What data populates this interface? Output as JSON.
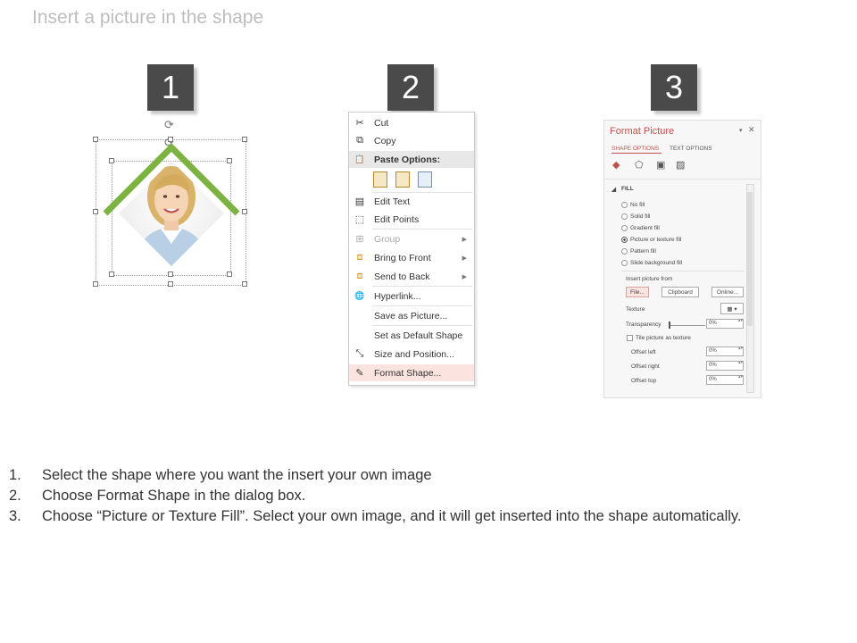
{
  "slide": {
    "title": "Insert a picture in the shape"
  },
  "steps": [
    "1",
    "2",
    "3"
  ],
  "shape": {
    "accent_color": "#7cb342",
    "shape_type": "diamond-with-roof",
    "image": "woman-portrait"
  },
  "context_menu": {
    "items": [
      {
        "icon": "scissors-icon",
        "glyph": "✂",
        "label": "Cut"
      },
      {
        "icon": "copy-icon",
        "glyph": "⧉",
        "label": "Copy"
      },
      {
        "icon": "paste-icon",
        "glyph": "📋",
        "label": "Paste Options:"
      },
      {
        "icon": "edit-text-icon",
        "glyph": "▤",
        "label": "Edit Text"
      },
      {
        "icon": "edit-points-icon",
        "glyph": "⬚",
        "label": "Edit Points"
      },
      {
        "icon": "group-icon",
        "glyph": "⊞",
        "label": "Group"
      },
      {
        "icon": "bring-to-front-icon",
        "glyph": "⧈",
        "label": "Bring to Front"
      },
      {
        "icon": "send-to-back-icon",
        "glyph": "⧈",
        "label": "Send to Back"
      },
      {
        "icon": "hyperlink-icon",
        "glyph": "🌐",
        "label": "Hyperlink..."
      },
      {
        "icon": "",
        "glyph": "",
        "label": "Save as Picture..."
      },
      {
        "icon": "",
        "glyph": "",
        "label": "Set as Default Shape"
      },
      {
        "icon": "size-position-icon",
        "glyph": "⤡",
        "label": "Size and Position..."
      },
      {
        "icon": "format-shape-icon",
        "glyph": "✎",
        "label": "Format Shape..."
      }
    ],
    "highlight_color": "#fbe3e0"
  },
  "format_pane": {
    "title": "Format Picture",
    "tab_shape": "SHAPE OPTIONS",
    "tab_text": "TEXT OPTIONS",
    "section": "FILL",
    "fill_options": [
      "No fill",
      "Solid fill",
      "Gradient fill",
      "Picture or texture fill",
      "Pattern fill",
      "Slide background fill"
    ],
    "selected_fill": "Picture or texture fill",
    "insert_from": "Insert picture from",
    "btn_file": "File...",
    "btn_clipboard": "Clipboard",
    "btn_online": "Online...",
    "texture": "Texture",
    "transparency": "Transparency",
    "transparency_value": "0%",
    "tile": "Tile picture as texture",
    "offset_left": "Offset left",
    "offset_left_value": "0%",
    "offset_right": "Offset right",
    "offset_right_value": "0%",
    "offset_top": "Offset top",
    "offset_top_value": "0%",
    "title_color": "#c0504d"
  },
  "instructions": [
    {
      "num": "1.",
      "text": "Select the shape where you want the insert your own image"
    },
    {
      "num": "2.",
      "text": "Choose Format Shape in the dialog box."
    },
    {
      "num": "3.",
      "text": "Choose “Picture or Texture Fill”. Select your own image, and it will get inserted into the shape automatically."
    }
  ]
}
